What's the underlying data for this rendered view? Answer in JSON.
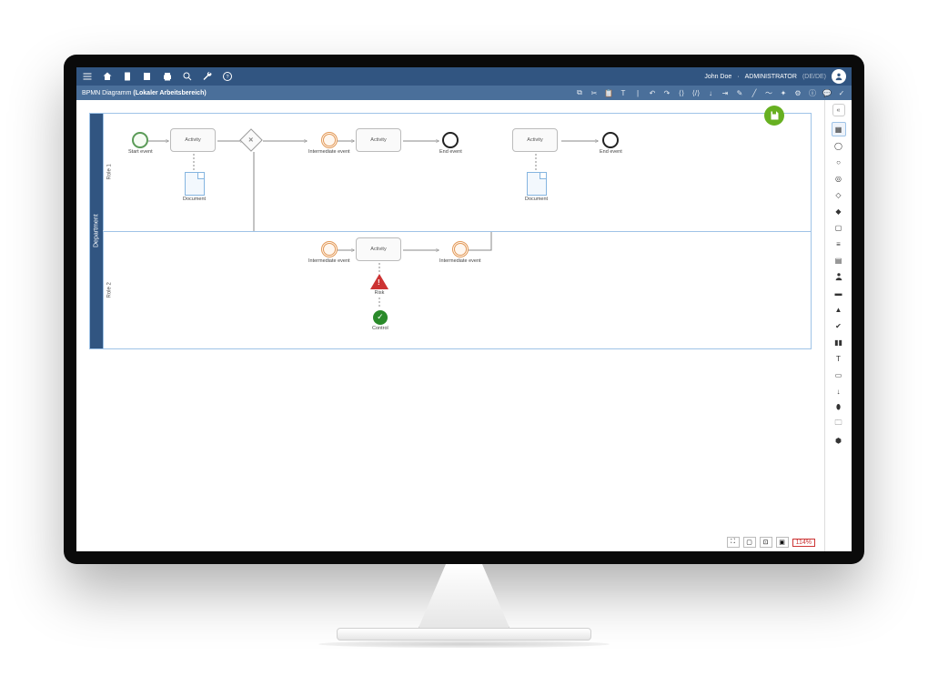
{
  "header": {
    "user": "John Doe",
    "role": "ADMINISTRATOR",
    "lang": "(DE/DE)"
  },
  "breadcrumb": {
    "prefix": "BPMN Diagramm",
    "location": "(Lokaler Arbeitsbereich)"
  },
  "pool": {
    "title": "Department"
  },
  "lanes": {
    "r1": "Role 1",
    "r2": "Role 2"
  },
  "labels": {
    "start": "Start event",
    "activity": "Activity",
    "inter": "Intermediate event",
    "end": "End event",
    "document": "Document",
    "risk": "Risk",
    "control": "Control"
  },
  "zoom": {
    "value": "114%"
  }
}
